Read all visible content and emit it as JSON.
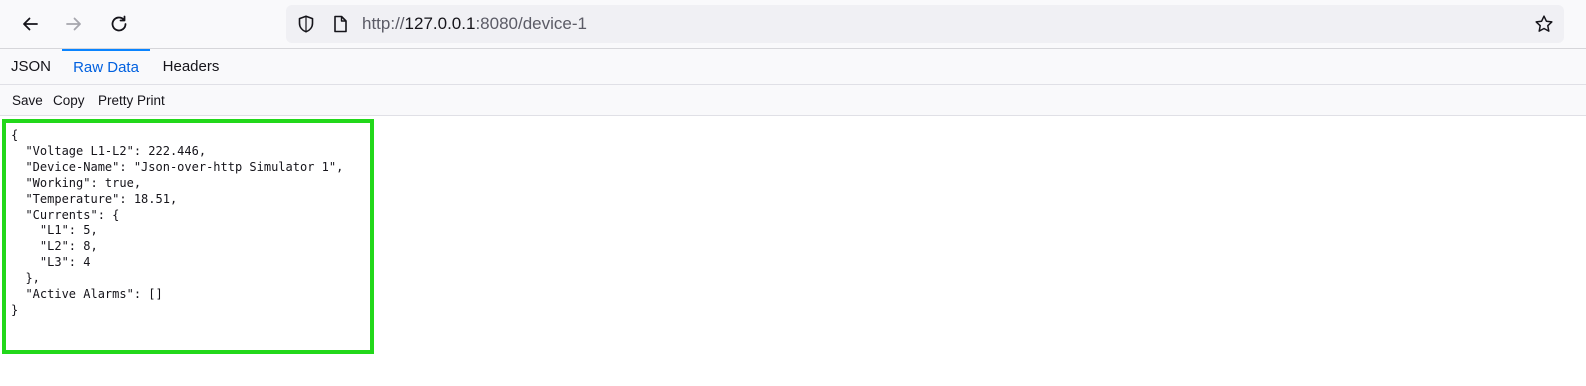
{
  "browser": {
    "back_icon": "arrow-left-icon",
    "forward_icon": "arrow-right-icon",
    "reload_icon": "reload-icon",
    "url_protocol": "http://",
    "url_host": "127.0.0.1",
    "url_rest": ":8080/device-1",
    "shield_icon": "shield-icon",
    "page_icon": "page-icon",
    "bookmark_icon": "star-icon"
  },
  "tabs": {
    "json": "JSON",
    "raw": "Raw Data",
    "headers": "Headers",
    "active": "Raw Data"
  },
  "actions": {
    "save": "Save",
    "copy": "Copy",
    "pretty_print": "Pretty Print"
  },
  "raw_data": "{\n  \"Voltage L1-L2\": 222.446,\n  \"Device-Name\": \"Json-over-http Simulator 1\",\n  \"Working\": true,\n  \"Temperature\": 18.51,\n  \"Currents\": {\n    \"L1\": 5,\n    \"L2\": 8,\n    \"L3\": 4\n  },\n  \"Active Alarms\": []\n}",
  "colors": {
    "highlight": "#22d81a",
    "active_tab": "#0060df"
  }
}
